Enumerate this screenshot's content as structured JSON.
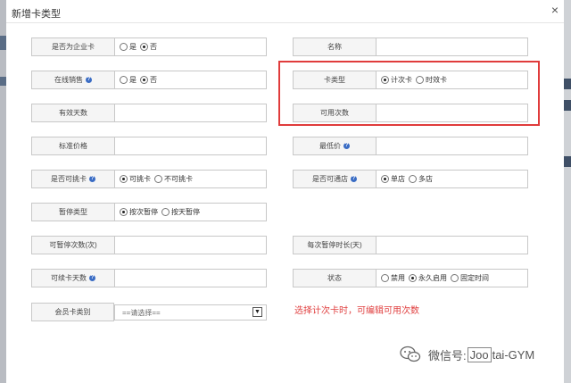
{
  "dialog": {
    "title": "新增卡类型",
    "close": "×"
  },
  "form": {
    "is_enterprise": {
      "label": "是否为企业卡",
      "options": [
        "是",
        "否"
      ],
      "selected": 1
    },
    "name": {
      "label": "名称",
      "value": ""
    },
    "online_sale": {
      "label": "在线销售",
      "options": [
        "是",
        "否"
      ],
      "selected": 1
    },
    "card_type": {
      "label": "卡类型",
      "options": [
        "计次卡",
        "时效卡"
      ],
      "selected": 0
    },
    "valid_days": {
      "label": "有效天数",
      "value": ""
    },
    "usable_times": {
      "label": "可用次数",
      "value": ""
    },
    "standard_price": {
      "label": "标准价格",
      "value": ""
    },
    "min_price": {
      "label": "最低价",
      "value": ""
    },
    "can_pick_card": {
      "label": "是否可挑卡",
      "options": [
        "可挑卡",
        "不可挑卡"
      ],
      "selected": 0
    },
    "multi_store": {
      "label": "是否可通店",
      "options": [
        "单店",
        "多店"
      ],
      "selected": 0
    },
    "pause_type": {
      "label": "暂停类型",
      "options": [
        "按次暂停",
        "按天暂停"
      ],
      "selected": 0
    },
    "pause_times": {
      "label": "可暂停次数(次)",
      "value": ""
    },
    "pause_duration": {
      "label": "每次暂停时长(天)",
      "value": ""
    },
    "renew_days": {
      "label": "可续卡天数",
      "value": ""
    },
    "status": {
      "label": "状态",
      "options": [
        "禁用",
        "永久启用",
        "固定时间"
      ],
      "selected": 1
    },
    "member_category": {
      "label": "会员卡类别",
      "value": "==请选择=="
    }
  },
  "annotation": {
    "note": "选择计次卡时，可编辑可用次数",
    "highlight_color": "#e03c3c"
  },
  "watermark": {
    "prefix": "微信号:",
    "boxed": "Joo",
    "suffix": "tai-GYM"
  },
  "help_icon_text": "?",
  "select_arrow": "▼"
}
